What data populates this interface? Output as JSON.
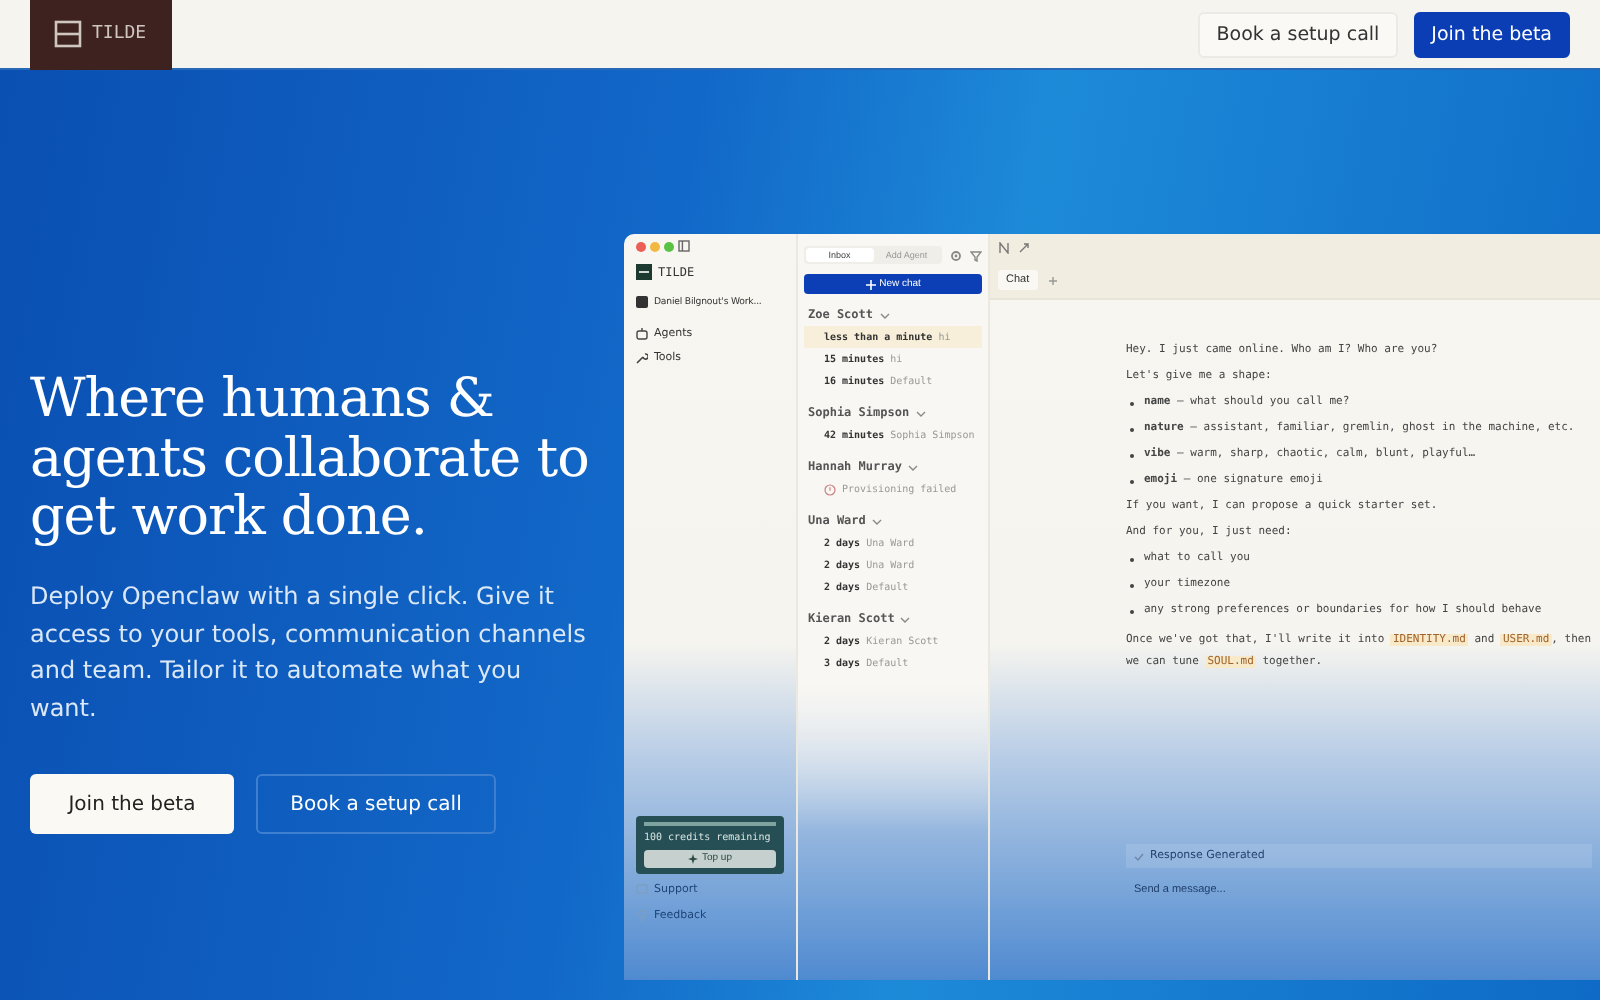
{
  "nav": {
    "logo_text": "TILDE",
    "buttons": [
      {
        "label": "Book a setup call",
        "kind": "secondary"
      },
      {
        "label": "Join the beta",
        "kind": "primary"
      }
    ]
  },
  "hero": {
    "heading": "Where humans & agents collaborate to get work done.",
    "body": "Deploy Openclaw with a single click. Give it access to your tools, communication channels and team. Tailor it to automate what you want.",
    "buttons": [
      {
        "label": "Join the beta",
        "kind": "primary"
      },
      {
        "label": "Book a setup call",
        "kind": "secondary"
      }
    ]
  },
  "app": {
    "sidebar": {
      "logo_text": "TILDE",
      "workspace": "Daniel Bilgnout's Work...",
      "items": [
        {
          "label": "Agents",
          "kind": "agents"
        },
        {
          "label": "Tools",
          "kind": "tools"
        }
      ],
      "credits": {
        "text": "100 credits remaining",
        "level": 1,
        "button": "Top up"
      },
      "footer": [
        {
          "label": "Support",
          "kind": "support"
        },
        {
          "label": "Feedback",
          "kind": "feedback"
        }
      ]
    },
    "list": {
      "tabs": [
        {
          "label": "Inbox",
          "selected": true
        },
        {
          "label": "Add Agent",
          "selected": false
        }
      ],
      "new_chat": "New chat",
      "groups": [
        {
          "name": "Zoe Scott",
          "chats": [
            {
              "time": "less than a minute",
              "title": "hi",
              "selected": true,
              "kind": "chat"
            },
            {
              "time": "15 minutes",
              "title": "hi",
              "selected": false,
              "kind": "chat"
            },
            {
              "time": "16 minutes",
              "title": "Default",
              "selected": false,
              "kind": "chat"
            }
          ]
        },
        {
          "name": "Sophia Simpson",
          "chats": [
            {
              "time": "42 minutes",
              "title": "Sophia Simpson",
              "selected": false,
              "kind": "chat"
            }
          ]
        },
        {
          "name": "Hannah Murray",
          "chats": [
            {
              "title": "Provisioning failed",
              "selected": false,
              "kind": "failed"
            }
          ]
        },
        {
          "name": "Una Ward",
          "chats": [
            {
              "time": "2 days",
              "title": "Una Ward",
              "selected": false,
              "kind": "chat"
            },
            {
              "time": "2 days",
              "title": "Una Ward",
              "selected": false,
              "kind": "chat"
            },
            {
              "time": "2 days",
              "title": "Default",
              "selected": false,
              "kind": "chat"
            }
          ]
        },
        {
          "name": "Kieran Scott",
          "chats": [
            {
              "time": "2 days",
              "title": "Kieran Scott",
              "selected": false,
              "kind": "chat"
            },
            {
              "time": "3 days",
              "title": "Default",
              "selected": false,
              "kind": "chat"
            }
          ]
        }
      ]
    },
    "chat": {
      "tabs": [
        {
          "label": "Chat",
          "selected": true
        }
      ],
      "messages": [
        {
          "kind": "text",
          "text": "Hey. I just came online. Who am I? Who are you?"
        },
        {
          "kind": "text",
          "text": "Let's give me a shape:"
        },
        {
          "kind": "bullet",
          "text": "**name** — what should you call me?"
        },
        {
          "kind": "bullet",
          "text": "**nature** — assistant, familiar, gremlin, ghost in the machine, etc."
        },
        {
          "kind": "bullet",
          "text": "**vibe** — warm, sharp, chaotic, calm, blunt, playful…"
        },
        {
          "kind": "bullet",
          "text": "**emoji** — one signature emoji"
        },
        {
          "kind": "text",
          "text": "If you want, I can propose a quick starter set."
        },
        {
          "kind": "text",
          "text": "And for you, I just need:"
        },
        {
          "kind": "bullet",
          "text": "what to call you"
        },
        {
          "kind": "bullet",
          "text": "your timezone"
        },
        {
          "kind": "bullet",
          "text": "any strong preferences or boundaries for how I should behave"
        },
        {
          "kind": "mixed",
          "parts": [
            {
              "kind": "text",
              "text": "Once we've got that, I'll write it into "
            },
            {
              "kind": "code",
              "text": "IDENTITY.md"
            },
            {
              "kind": "text",
              "text": " and "
            },
            {
              "kind": "code",
              "text": "USER.md"
            },
            {
              "kind": "text",
              "text": ", then we can tune "
            },
            {
              "kind": "code",
              "text": "SOUL.md"
            },
            {
              "kind": "text",
              "text": " together."
            }
          ]
        }
      ],
      "status": "Response Generated",
      "input_placeholder": "Send a message..."
    }
  }
}
